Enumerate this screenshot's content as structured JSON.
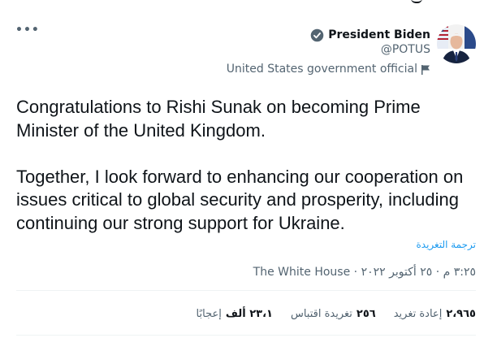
{
  "author": {
    "name": "President Biden",
    "handle": "@POTUS",
    "label": "United States government official"
  },
  "tweet": {
    "paragraph_1": "Congratulations to Rishi Sunak on becoming Prime Minister of the United Kingdom.",
    "paragraph_2": "Together, I look forward to enhancing our cooperation on issues critical to global security and prosperity, including continuing our strong support for Ukraine.",
    "translate": "ترجمة التغريدة"
  },
  "meta": {
    "time": "٣:٢٥ م",
    "separator": "·",
    "date": "٢٥ أكتوبر ٢٠٢٢",
    "source": "The White House"
  },
  "stats": {
    "retweets": {
      "value": "٢،٩٦٥",
      "label": "إعادة تغريد"
    },
    "quotes": {
      "value": "٢٥٦",
      "label": "تغريدة اقتباس"
    },
    "likes": {
      "value": "٢٣،١ ألف",
      "label": "إعجابًا"
    }
  },
  "colors": {
    "text": "#0f1419",
    "secondary": "#536471",
    "link": "#1d9bf0",
    "divider": "#eff3f4"
  },
  "icons": [
    "more-icon",
    "verified-badge-icon",
    "flag-icon"
  ]
}
